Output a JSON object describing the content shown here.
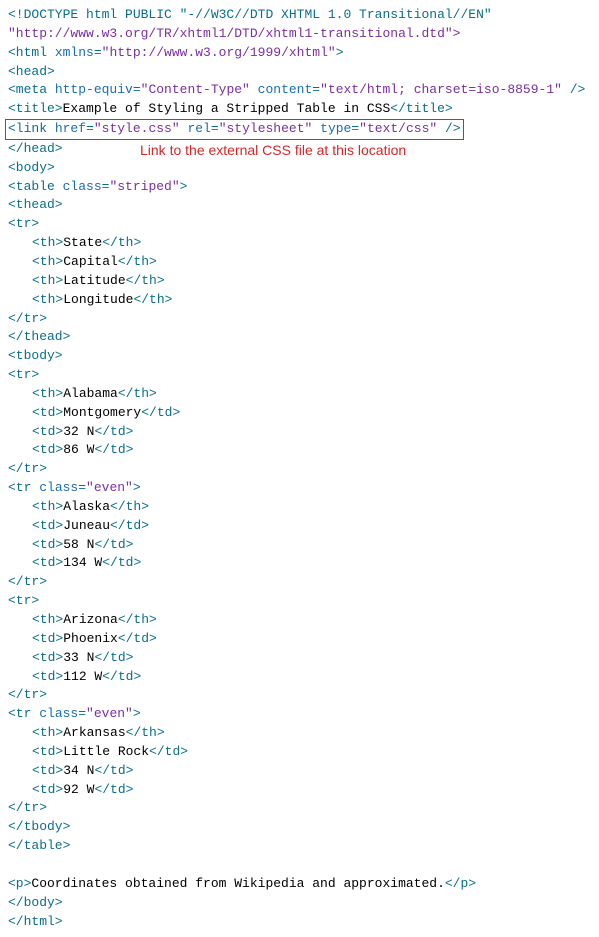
{
  "annotation": "Link to the external CSS file at this location",
  "code": {
    "doctype": "<!DOCTYPE html PUBLIC \"-//W3C//DTD XHTML 1.0 Transitional//EN\"",
    "dtd_url": "\"http://www.w3.org/TR/xhtml1/DTD/xhtml1-transitional.dtd\">",
    "html_open": "<html xmlns=\"http://www.w3.org/1999/xhtml\">",
    "head_open": "<head>",
    "meta": {
      "attr1": "http-equiv",
      "val1": "\"Content-Type\"",
      "attr2": "content",
      "val2": "\"text/html; charset=iso-8859-1\""
    },
    "title_text": "Example of Styling a Stripped Table in CSS",
    "link": {
      "attr1": "href",
      "val1": "\"style.css\"",
      "attr2": "rel",
      "val2": "\"stylesheet\"",
      "attr3": "type",
      "val3": "\"text/css\""
    },
    "head_close": "</head>",
    "body_open": "<body>",
    "table_open_attr": "class",
    "table_open_val": "\"striped\"",
    "thead_open": "<thead>",
    "tr_open": "<tr>",
    "tr_close": "</tr>",
    "tr_even_attr": "class",
    "tr_even_val": "\"even\"",
    "thead_close": "</thead>",
    "tbody_open": "<tbody>",
    "tbody_close": "</tbody>",
    "table_close": "</table>",
    "body_close": "</body>",
    "html_close": "</html>",
    "headers": {
      "h1": "State",
      "h2": "Capital",
      "h3": "Latitude",
      "h4": "Longitude"
    },
    "rows": [
      {
        "th": "Alabama",
        "td1": "Montgomery",
        "td2": "32 N",
        "td3": "86 W"
      },
      {
        "th": "Alaska",
        "td1": "Juneau",
        "td2": "58 N",
        "td3": "134 W"
      },
      {
        "th": "Arizona",
        "td1": "Phoenix",
        "td2": "33 N",
        "td3": "112 W"
      },
      {
        "th": "Arkansas",
        "td1": "Little Rock",
        "td2": "34 N",
        "td3": "92 W"
      }
    ],
    "footer_text": "Coordinates obtained from Wikipedia and approximated."
  }
}
